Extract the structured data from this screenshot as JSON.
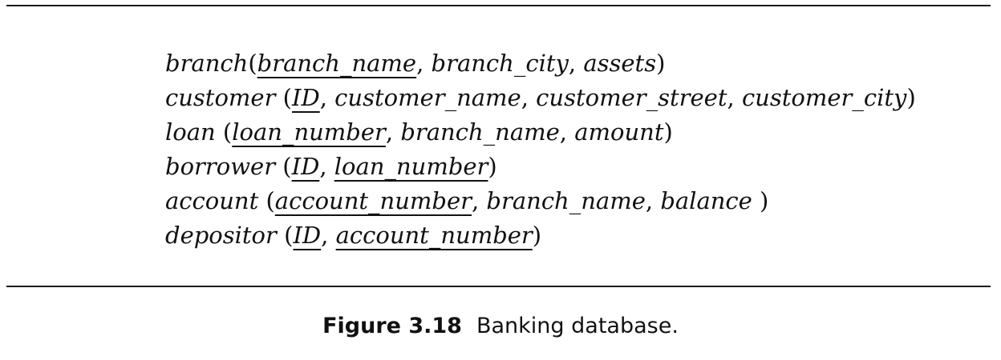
{
  "schema": [
    {
      "relation": "branch",
      "open": "(",
      "close": ")",
      "attributes": [
        {
          "name": "branch_name",
          "primary_key": true
        },
        {
          "name": "branch_city",
          "primary_key": false
        },
        {
          "name": "assets",
          "primary_key": false
        }
      ]
    },
    {
      "relation": "customer",
      "open": " (",
      "close": ")",
      "attributes": [
        {
          "name": "ID",
          "primary_key": true
        },
        {
          "name": "customer_name",
          "primary_key": false
        },
        {
          "name": "customer_street",
          "primary_key": false
        },
        {
          "name": "customer_city",
          "primary_key": false
        }
      ]
    },
    {
      "relation": "loan",
      "open": " (",
      "close": ")",
      "attributes": [
        {
          "name": "loan_number",
          "primary_key": true
        },
        {
          "name": "branch_name",
          "primary_key": false
        },
        {
          "name": "amount",
          "primary_key": false
        }
      ]
    },
    {
      "relation": "borrower",
      "open": " (",
      "close": ")",
      "attributes": [
        {
          "name": "ID",
          "primary_key": true
        },
        {
          "name": "loan_number",
          "primary_key": true
        }
      ]
    },
    {
      "relation": "account",
      "open": " (",
      "close": " )",
      "attributes": [
        {
          "name": "account_number",
          "primary_key": true
        },
        {
          "name": "branch_name",
          "primary_key": false
        },
        {
          "name": "balance",
          "primary_key": false
        }
      ]
    },
    {
      "relation": "depositor",
      "open": " (",
      "close": ")",
      "attributes": [
        {
          "name": "ID",
          "primary_key": true
        },
        {
          "name": "account_number",
          "primary_key": true
        }
      ]
    }
  ],
  "caption": {
    "label": "Figure 3.18",
    "text": "Banking database."
  }
}
